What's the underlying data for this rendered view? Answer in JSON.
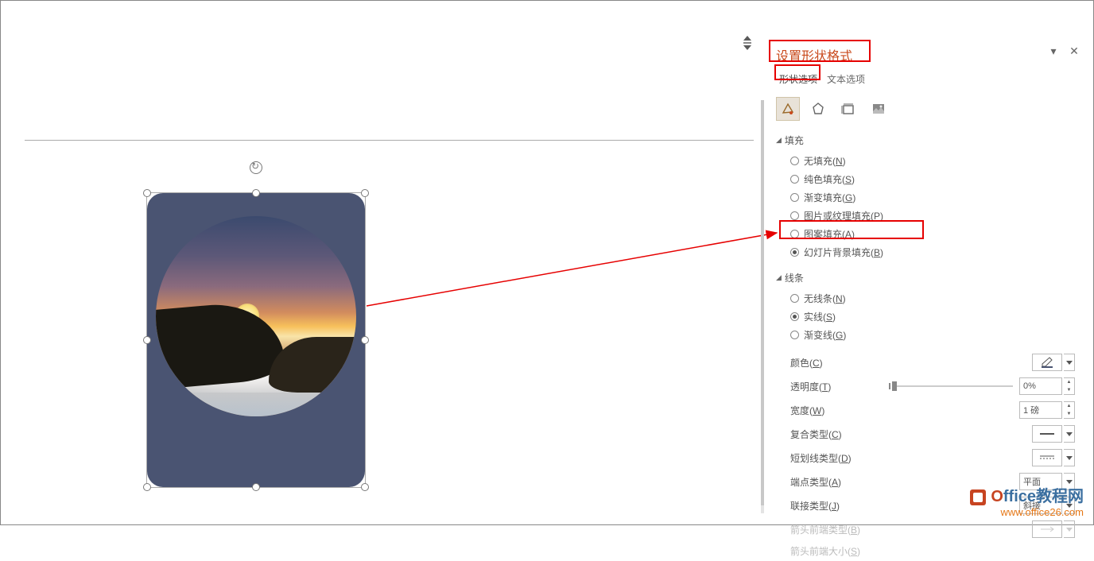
{
  "panel": {
    "title": "设置形状格式",
    "tabs": {
      "shape": "形状选项",
      "text": "文本选项"
    },
    "fill": {
      "header": "填充",
      "options": {
        "none": {
          "label": "无填充(",
          "accel": "N",
          "suffix": ")"
        },
        "solid": {
          "label": "纯色填充(",
          "accel": "S",
          "suffix": ")"
        },
        "grad": {
          "label": "渐变填充(",
          "accel": "G",
          "suffix": ")"
        },
        "pic": {
          "label": "图片或纹理填充(",
          "accel": "P",
          "suffix": ")"
        },
        "pattern": {
          "label": "图案填充(",
          "accel": "A",
          "suffix": ")"
        },
        "bg": {
          "label": "幻灯片背景填充(",
          "accel": "B",
          "suffix": ")"
        }
      }
    },
    "line": {
      "header": "线条",
      "options": {
        "none": {
          "label": "无线条(",
          "accel": "N",
          "suffix": ")"
        },
        "solid": {
          "label": "实线(",
          "accel": "S",
          "suffix": ")"
        },
        "grad": {
          "label": "渐变线(",
          "accel": "G",
          "suffix": ")"
        }
      },
      "props": {
        "color": {
          "label": "颜色(",
          "accel": "C",
          "suffix": ")"
        },
        "transparency": {
          "label": "透明度(",
          "accel": "T",
          "suffix": ")",
          "value": "0%"
        },
        "width": {
          "label": "宽度(",
          "accel": "W",
          "suffix": ")",
          "value": "1 磅"
        },
        "compound": {
          "label": "复合类型(",
          "accel": "C",
          "suffix": ")"
        },
        "dash": {
          "label": "短划线类型(",
          "accel": "D",
          "suffix": ")"
        },
        "cap": {
          "label": "端点类型(",
          "accel": "A",
          "suffix": ")",
          "value": "平面"
        },
        "join": {
          "label": "联接类型(",
          "accel": "J",
          "suffix": ")",
          "value": "斜接"
        },
        "arrowBegin": {
          "label": "箭头前端类型(",
          "accel": "B",
          "suffix": ")"
        },
        "arrowBeginSize": {
          "label": "箭头前端大小(",
          "accel": "S",
          "suffix": ")"
        }
      }
    }
  },
  "watermark": {
    "brand_prefix": "O",
    "brand_rest": "ffice教程网",
    "url": "www.office26.com"
  }
}
